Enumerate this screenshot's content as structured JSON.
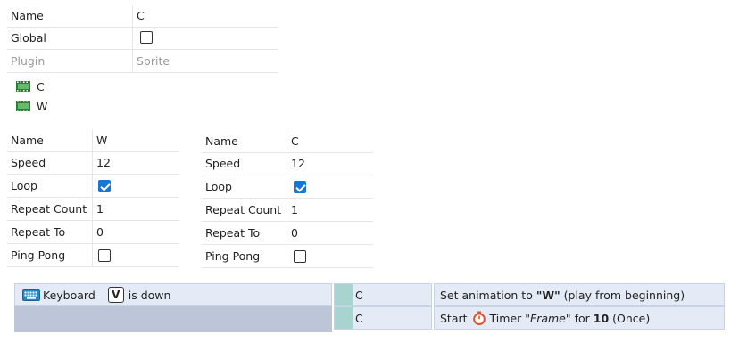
{
  "object_props": {
    "rows": [
      {
        "label": "Name",
        "value": "C"
      },
      {
        "label": "Global",
        "checked": false
      },
      {
        "label": "Plugin",
        "value": "Sprite"
      }
    ]
  },
  "animations": [
    {
      "name": "C",
      "icon": "film-strip-icon",
      "color": "#2e7d32"
    },
    {
      "name": "W",
      "icon": "film-strip-icon",
      "color": "#2e7d32"
    }
  ],
  "anim_props_w": {
    "name_label": "Name",
    "name_value": "W",
    "speed_label": "Speed",
    "speed_value": "12",
    "loop_label": "Loop",
    "loop_checked": true,
    "repeat_count_label": "Repeat Count",
    "repeat_count_value": "1",
    "repeat_to_label": "Repeat To",
    "repeat_to_value": "0",
    "ping_pong_label": "Ping Pong",
    "ping_pong_checked": false
  },
  "anim_props_c": {
    "name_label": "Name",
    "name_value": "C",
    "speed_label": "Speed",
    "speed_value": "12",
    "loop_label": "Loop",
    "loop_checked": true,
    "repeat_count_label": "Repeat Count",
    "repeat_count_value": "1",
    "repeat_to_label": "Repeat To",
    "repeat_to_value": "0",
    "ping_pong_label": "Ping Pong",
    "ping_pong_checked": false
  },
  "event": {
    "condition": {
      "object": "Keyboard",
      "key": "V",
      "text": "is down"
    },
    "actions": [
      {
        "object": "C",
        "prefix": "Set animation to ",
        "anim": "\"W\"",
        "suffix": " (play from beginning)"
      },
      {
        "object": "C",
        "start": "Start",
        "timer": "Timer",
        "timer_name": "\"Frame\"",
        "for": "for",
        "duration": "10",
        "mode": "(Once)"
      }
    ]
  },
  "colors": {
    "checkbox_accent": "#1976d2",
    "event_bg": "#e5ebf6",
    "object_swatch": "#a8d4d0",
    "timer_icon": "#e0522a"
  }
}
